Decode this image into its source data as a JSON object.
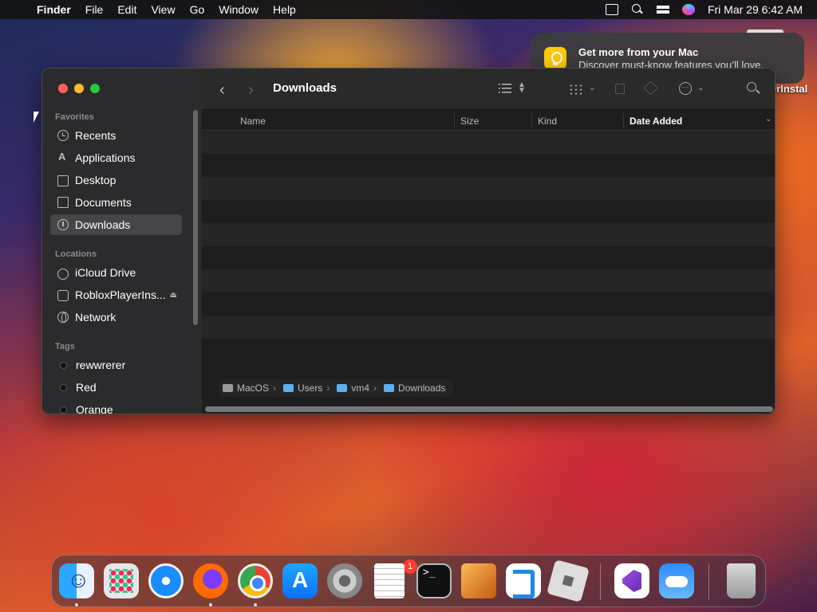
{
  "menubar": {
    "app_name": "Finder",
    "menus": [
      "File",
      "Edit",
      "View",
      "Go",
      "Window",
      "Help"
    ],
    "clock": "Fri Mar 29  6:42 AM"
  },
  "notification": {
    "title": "Get more from your Mac",
    "body": "Discover must-know features you’ll love."
  },
  "desktop": {
    "partial_label": "erInstal"
  },
  "finder": {
    "title": "Downloads",
    "sidebar": {
      "favorites_header": "Favorites",
      "favorites": [
        {
          "label": "Recents",
          "icon": "clock-icon"
        },
        {
          "label": "Applications",
          "icon": "applications-icon"
        },
        {
          "label": "Desktop",
          "icon": "desktop-icon"
        },
        {
          "label": "Documents",
          "icon": "document-icon"
        },
        {
          "label": "Downloads",
          "icon": "download-icon",
          "selected": true
        }
      ],
      "locations_header": "Locations",
      "locations": [
        {
          "label": "iCloud Drive",
          "icon": "cloud-icon"
        },
        {
          "label": "RobloxPlayerIns...",
          "icon": "drive-icon",
          "eject": "⏏"
        },
        {
          "label": "Network",
          "icon": "globe-icon"
        }
      ],
      "tags_header": "Tags",
      "tags": [
        {
          "label": "rewwrerer"
        },
        {
          "label": "Red"
        },
        {
          "label": "Orange"
        }
      ]
    },
    "columns": {
      "name": "Name",
      "size": "Size",
      "kind": "Kind",
      "date_added": "Date Added"
    },
    "path": [
      "MacOS",
      "Users",
      "vm4",
      "Downloads"
    ]
  },
  "dock": {
    "apps": [
      {
        "name": "finder-icon",
        "running": true
      },
      {
        "name": "launchpad-icon"
      },
      {
        "name": "safari-icon"
      },
      {
        "name": "firefox-icon",
        "running": true
      },
      {
        "name": "chrome-icon",
        "running": true
      },
      {
        "name": "app-store-icon"
      },
      {
        "name": "system-settings-icon",
        "badge": "1"
      },
      {
        "name": "textedit-icon"
      },
      {
        "name": "terminal-icon"
      },
      {
        "name": "garageband-icon"
      },
      {
        "name": "vscode-icon"
      },
      {
        "name": "roblox-icon"
      },
      {
        "name": "visual-studio-icon"
      },
      {
        "name": "weather-icon"
      },
      {
        "name": "trash-icon"
      }
    ],
    "settings_badge": "1"
  },
  "colors": {
    "selection": "#464648",
    "folder": "#5ab0f0",
    "badge": "#ff3b30"
  }
}
